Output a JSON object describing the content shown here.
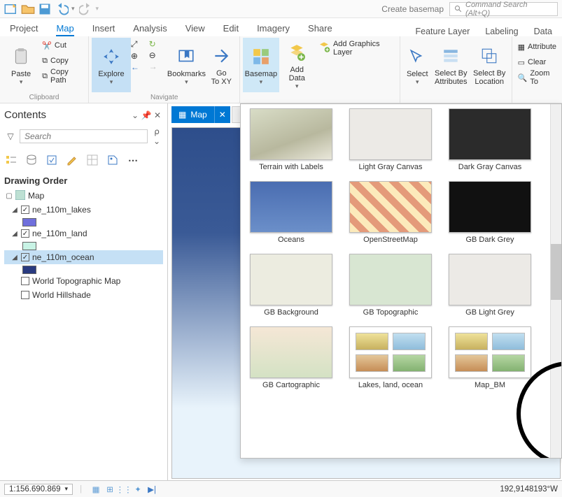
{
  "qa": {
    "create_basemap": "Create basemap",
    "cmd_placeholder": "Command Search (Alt+Q)"
  },
  "ribbon_tabs": {
    "project": "Project",
    "map": "Map",
    "insert": "Insert",
    "analysis": "Analysis",
    "view": "View",
    "edit": "Edit",
    "imagery": "Imagery",
    "share": "Share",
    "ctx1": "Feature Layer",
    "ctx2": "Labeling",
    "ctx3": "Data"
  },
  "ribbon": {
    "clipboard": {
      "label": "Clipboard",
      "paste": "Paste",
      "cut": "Cut",
      "copy": "Copy",
      "copy_path": "Copy Path"
    },
    "navigate": {
      "label": "Navigate",
      "explore": "Explore",
      "bookmarks": "Bookmarks",
      "goxy": "Go\nTo XY"
    },
    "layer": {
      "basemap": "Basemap",
      "adddata": "Add\nData",
      "add_graphics": "Add Graphics Layer"
    },
    "selection": {
      "select": "Select",
      "by_attr": "Select By\nAttributes",
      "by_loc": "Select By\nLocation"
    },
    "right": {
      "attr": "Attribute",
      "clear": "Clear",
      "zoom": "Zoom To"
    }
  },
  "contents": {
    "title": "Contents",
    "search_placeholder": "Search",
    "section": "Drawing Order",
    "map_name": "Map",
    "layers": [
      {
        "name": "ne_110m_lakes",
        "checked": true,
        "color": "#6f6fdc"
      },
      {
        "name": "ne_110m_land",
        "checked": true,
        "color": "#c8f3e5"
      },
      {
        "name": "ne_110m_ocean",
        "checked": true,
        "color": "#293a80",
        "selected": true
      },
      {
        "name": "World Topographic Map",
        "checked": false,
        "color": null
      },
      {
        "name": "World Hillshade",
        "checked": false,
        "color": null
      }
    ]
  },
  "maptab": {
    "name": "Map"
  },
  "gallery": {
    "rows": [
      [
        {
          "label": "Terrain with Labels",
          "cls": "terrain"
        },
        {
          "label": "Light Gray Canvas",
          "cls": "lg"
        },
        {
          "label": "Dark Gray Canvas",
          "cls": "dg"
        }
      ],
      [
        {
          "label": "Oceans",
          "cls": "ocean"
        },
        {
          "label": "OpenStreetMap",
          "cls": "osm"
        },
        {
          "label": "GB Dark Grey",
          "cls": "gdark"
        }
      ],
      [
        {
          "label": "GB Background",
          "cls": "gbbg"
        },
        {
          "label": "GB Topographic",
          "cls": "gbtopo"
        },
        {
          "label": "GB Light Grey",
          "cls": "gblight"
        }
      ],
      [
        {
          "label": "GB Cartographic",
          "cls": "gbcart"
        },
        {
          "label": "Lakes, land, ocean",
          "cls": "fourpatch"
        },
        {
          "label": "Map_BM",
          "cls": "fourpatch"
        }
      ]
    ]
  },
  "status": {
    "scale": "1:156.690.869",
    "coord": "192,9148193°W"
  }
}
